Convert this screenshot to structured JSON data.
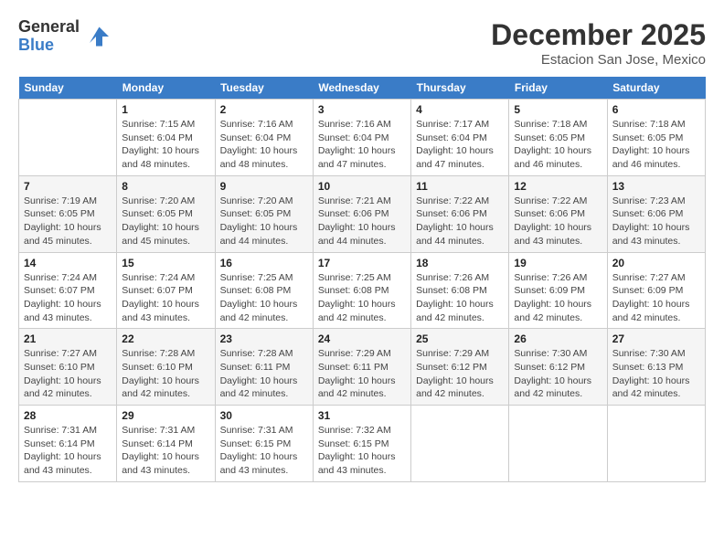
{
  "header": {
    "logo": {
      "general": "General",
      "blue": "Blue"
    },
    "title": "December 2025",
    "location": "Estacion San Jose, Mexico"
  },
  "calendar": {
    "days_of_week": [
      "Sunday",
      "Monday",
      "Tuesday",
      "Wednesday",
      "Thursday",
      "Friday",
      "Saturday"
    ],
    "weeks": [
      [
        {
          "day": "",
          "info": ""
        },
        {
          "day": "1",
          "info": "Sunrise: 7:15 AM\nSunset: 6:04 PM\nDaylight: 10 hours\nand 48 minutes."
        },
        {
          "day": "2",
          "info": "Sunrise: 7:16 AM\nSunset: 6:04 PM\nDaylight: 10 hours\nand 48 minutes."
        },
        {
          "day": "3",
          "info": "Sunrise: 7:16 AM\nSunset: 6:04 PM\nDaylight: 10 hours\nand 47 minutes."
        },
        {
          "day": "4",
          "info": "Sunrise: 7:17 AM\nSunset: 6:04 PM\nDaylight: 10 hours\nand 47 minutes."
        },
        {
          "day": "5",
          "info": "Sunrise: 7:18 AM\nSunset: 6:05 PM\nDaylight: 10 hours\nand 46 minutes."
        },
        {
          "day": "6",
          "info": "Sunrise: 7:18 AM\nSunset: 6:05 PM\nDaylight: 10 hours\nand 46 minutes."
        }
      ],
      [
        {
          "day": "7",
          "info": "Sunrise: 7:19 AM\nSunset: 6:05 PM\nDaylight: 10 hours\nand 45 minutes."
        },
        {
          "day": "8",
          "info": "Sunrise: 7:20 AM\nSunset: 6:05 PM\nDaylight: 10 hours\nand 45 minutes."
        },
        {
          "day": "9",
          "info": "Sunrise: 7:20 AM\nSunset: 6:05 PM\nDaylight: 10 hours\nand 44 minutes."
        },
        {
          "day": "10",
          "info": "Sunrise: 7:21 AM\nSunset: 6:06 PM\nDaylight: 10 hours\nand 44 minutes."
        },
        {
          "day": "11",
          "info": "Sunrise: 7:22 AM\nSunset: 6:06 PM\nDaylight: 10 hours\nand 44 minutes."
        },
        {
          "day": "12",
          "info": "Sunrise: 7:22 AM\nSunset: 6:06 PM\nDaylight: 10 hours\nand 43 minutes."
        },
        {
          "day": "13",
          "info": "Sunrise: 7:23 AM\nSunset: 6:06 PM\nDaylight: 10 hours\nand 43 minutes."
        }
      ],
      [
        {
          "day": "14",
          "info": "Sunrise: 7:24 AM\nSunset: 6:07 PM\nDaylight: 10 hours\nand 43 minutes."
        },
        {
          "day": "15",
          "info": "Sunrise: 7:24 AM\nSunset: 6:07 PM\nDaylight: 10 hours\nand 43 minutes."
        },
        {
          "day": "16",
          "info": "Sunrise: 7:25 AM\nSunset: 6:08 PM\nDaylight: 10 hours\nand 42 minutes."
        },
        {
          "day": "17",
          "info": "Sunrise: 7:25 AM\nSunset: 6:08 PM\nDaylight: 10 hours\nand 42 minutes."
        },
        {
          "day": "18",
          "info": "Sunrise: 7:26 AM\nSunset: 6:08 PM\nDaylight: 10 hours\nand 42 minutes."
        },
        {
          "day": "19",
          "info": "Sunrise: 7:26 AM\nSunset: 6:09 PM\nDaylight: 10 hours\nand 42 minutes."
        },
        {
          "day": "20",
          "info": "Sunrise: 7:27 AM\nSunset: 6:09 PM\nDaylight: 10 hours\nand 42 minutes."
        }
      ],
      [
        {
          "day": "21",
          "info": "Sunrise: 7:27 AM\nSunset: 6:10 PM\nDaylight: 10 hours\nand 42 minutes."
        },
        {
          "day": "22",
          "info": "Sunrise: 7:28 AM\nSunset: 6:10 PM\nDaylight: 10 hours\nand 42 minutes."
        },
        {
          "day": "23",
          "info": "Sunrise: 7:28 AM\nSunset: 6:11 PM\nDaylight: 10 hours\nand 42 minutes."
        },
        {
          "day": "24",
          "info": "Sunrise: 7:29 AM\nSunset: 6:11 PM\nDaylight: 10 hours\nand 42 minutes."
        },
        {
          "day": "25",
          "info": "Sunrise: 7:29 AM\nSunset: 6:12 PM\nDaylight: 10 hours\nand 42 minutes."
        },
        {
          "day": "26",
          "info": "Sunrise: 7:30 AM\nSunset: 6:12 PM\nDaylight: 10 hours\nand 42 minutes."
        },
        {
          "day": "27",
          "info": "Sunrise: 7:30 AM\nSunset: 6:13 PM\nDaylight: 10 hours\nand 42 minutes."
        }
      ],
      [
        {
          "day": "28",
          "info": "Sunrise: 7:31 AM\nSunset: 6:14 PM\nDaylight: 10 hours\nand 43 minutes."
        },
        {
          "day": "29",
          "info": "Sunrise: 7:31 AM\nSunset: 6:14 PM\nDaylight: 10 hours\nand 43 minutes."
        },
        {
          "day": "30",
          "info": "Sunrise: 7:31 AM\nSunset: 6:15 PM\nDaylight: 10 hours\nand 43 minutes."
        },
        {
          "day": "31",
          "info": "Sunrise: 7:32 AM\nSunset: 6:15 PM\nDaylight: 10 hours\nand 43 minutes."
        },
        {
          "day": "",
          "info": ""
        },
        {
          "day": "",
          "info": ""
        },
        {
          "day": "",
          "info": ""
        }
      ]
    ]
  }
}
